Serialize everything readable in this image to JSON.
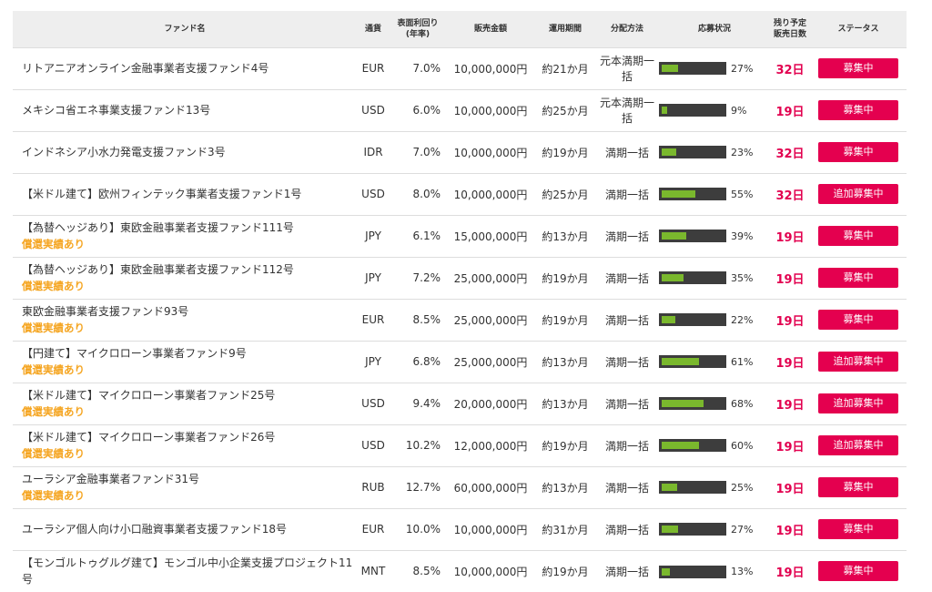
{
  "headers": {
    "name": "ファンド名",
    "currency": "通貨",
    "yield_line1": "表面利回り",
    "yield_line2": "(年率)",
    "amount": "販売金額",
    "period": "運用期間",
    "distribution": "分配方法",
    "progress": "応募状況",
    "days_line1": "残り予定",
    "days_line2": "販売日数",
    "status": "ステータス"
  },
  "colors": {
    "progress_fill": "#7ab82d",
    "status_red": "#e4004f",
    "guarantee_orange": "#f5a623"
  },
  "rows": [
    {
      "name": "リトアニアオンライン金融事業者支援ファンド4号",
      "note": "",
      "currency": "EUR",
      "yield": "7.0%",
      "amount": "10,000,000円",
      "period": "約21か月",
      "distribution": "元本満期一括",
      "progress": 27,
      "progress_label": "27%",
      "days": "32日",
      "status": "募集中"
    },
    {
      "name": "メキシコ省エネ事業支援ファンド13号",
      "note": "",
      "currency": "USD",
      "yield": "6.0%",
      "amount": "10,000,000円",
      "period": "約25か月",
      "distribution": "元本満期一括",
      "progress": 9,
      "progress_label": "9%",
      "days": "19日",
      "status": "募集中"
    },
    {
      "name": "インドネシア小水力発電支援ファンド3号",
      "note": "",
      "currency": "IDR",
      "yield": "7.0%",
      "amount": "10,000,000円",
      "period": "約19か月",
      "distribution": "満期一括",
      "progress": 23,
      "progress_label": "23%",
      "days": "32日",
      "status": "募集中"
    },
    {
      "name": "【米ドル建て】欧州フィンテック事業者支援ファンド1号",
      "note": "",
      "currency": "USD",
      "yield": "8.0%",
      "amount": "10,000,000円",
      "period": "約25か月",
      "distribution": "満期一括",
      "progress": 55,
      "progress_label": "55%",
      "days": "32日",
      "status": "追加募集中"
    },
    {
      "name": "【為替ヘッジあり】東欧金融事業者支援ファンド111号",
      "note": "償還実績あり",
      "currency": "JPY",
      "yield": "6.1%",
      "amount": "15,000,000円",
      "period": "約13か月",
      "distribution": "満期一括",
      "progress": 39,
      "progress_label": "39%",
      "days": "19日",
      "status": "募集中"
    },
    {
      "name": "【為替ヘッジあり】東欧金融事業者支援ファンド112号",
      "note": "償還実績あり",
      "currency": "JPY",
      "yield": "7.2%",
      "amount": "25,000,000円",
      "period": "約19か月",
      "distribution": "満期一括",
      "progress": 35,
      "progress_label": "35%",
      "days": "19日",
      "status": "募集中"
    },
    {
      "name": "東欧金融事業者支援ファンド93号",
      "note": "償還実績あり",
      "currency": "EUR",
      "yield": "8.5%",
      "amount": "25,000,000円",
      "period": "約19か月",
      "distribution": "満期一括",
      "progress": 22,
      "progress_label": "22%",
      "days": "19日",
      "status": "募集中"
    },
    {
      "name": "【円建て】マイクロローン事業者ファンド9号",
      "note": "償還実績あり",
      "currency": "JPY",
      "yield": "6.8%",
      "amount": "25,000,000円",
      "period": "約13か月",
      "distribution": "満期一括",
      "progress": 61,
      "progress_label": "61%",
      "days": "19日",
      "status": "追加募集中"
    },
    {
      "name": "【米ドル建て】マイクロローン事業者ファンド25号",
      "note": "償還実績あり",
      "currency": "USD",
      "yield": "9.4%",
      "amount": "20,000,000円",
      "period": "約13か月",
      "distribution": "満期一括",
      "progress": 68,
      "progress_label": "68%",
      "days": "19日",
      "status": "追加募集中"
    },
    {
      "name": "【米ドル建て】マイクロローン事業者ファンド26号",
      "note": "償還実績あり",
      "currency": "USD",
      "yield": "10.2%",
      "amount": "12,000,000円",
      "period": "約19か月",
      "distribution": "満期一括",
      "progress": 60,
      "progress_label": "60%",
      "days": "19日",
      "status": "追加募集中"
    },
    {
      "name": "ユーラシア金融事業者ファンド31号",
      "note": "償還実績あり",
      "currency": "RUB",
      "yield": "12.7%",
      "amount": "60,000,000円",
      "period": "約13か月",
      "distribution": "満期一括",
      "progress": 25,
      "progress_label": "25%",
      "days": "19日",
      "status": "募集中"
    },
    {
      "name": "ユーラシア個人向け小口融資事業者支援ファンド18号",
      "note": "",
      "currency": "EUR",
      "yield": "10.0%",
      "amount": "10,000,000円",
      "period": "約31か月",
      "distribution": "満期一括",
      "progress": 27,
      "progress_label": "27%",
      "days": "19日",
      "status": "募集中"
    },
    {
      "name": "【モンゴルトゥグルグ建て】モンゴル中小企業支援プロジェクト11号",
      "note": "",
      "currency": "MNT",
      "yield": "8.5%",
      "amount": "10,000,000円",
      "period": "約19か月",
      "distribution": "満期一括",
      "progress": 13,
      "progress_label": "13%",
      "days": "19日",
      "status": "募集中"
    }
  ]
}
